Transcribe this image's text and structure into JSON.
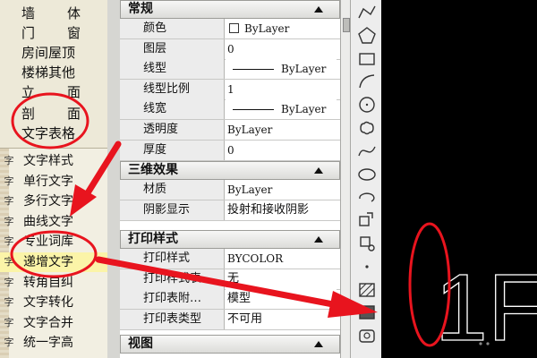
{
  "menu": {
    "top_items": [
      {
        "label": "墙体"
      },
      {
        "label": "门窗"
      },
      {
        "label": "房间屋顶"
      },
      {
        "label": "楼梯其他"
      },
      {
        "label": "立面"
      },
      {
        "label": "剖面"
      },
      {
        "label": "文字表格"
      }
    ],
    "sub_items": [
      {
        "label": "文字样式",
        "icon": "text-style-icon"
      },
      {
        "label": "单行文字",
        "icon": "single-line-text-icon"
      },
      {
        "label": "多行文字",
        "icon": "multiline-text-icon"
      },
      {
        "label": "曲线文字",
        "icon": "curve-text-icon"
      },
      {
        "label": "专业词库",
        "icon": "dictionary-icon"
      },
      {
        "label": "递增文字",
        "icon": "increment-text-icon",
        "highlighted": true
      },
      {
        "label": "转角自纠",
        "icon": "corner-text-icon"
      },
      {
        "label": "文字转化",
        "icon": "text-convert-icon"
      },
      {
        "label": "文字合并",
        "icon": "text-merge-icon"
      },
      {
        "label": "统一字高",
        "icon": "uniform-height-icon"
      }
    ]
  },
  "palette": {
    "sections": [
      {
        "title": "常规",
        "rows": [
          {
            "name": "颜色",
            "value": "ByLayer",
            "swatch": true
          },
          {
            "name": "图层",
            "value": "0"
          },
          {
            "name": "线型",
            "value": "ByLayer",
            "line": true
          },
          {
            "name": "线型比例",
            "value": "1"
          },
          {
            "name": "线宽",
            "value": "ByLayer",
            "line": true
          },
          {
            "name": "透明度",
            "value": "ByLayer"
          },
          {
            "name": "厚度",
            "value": "0"
          }
        ]
      },
      {
        "title": "三维效果",
        "rows": [
          {
            "name": "材质",
            "value": "ByLayer"
          },
          {
            "name": "阴影显示",
            "value": "投射和接收阴影"
          }
        ]
      },
      {
        "title": "打印样式",
        "rows": [
          {
            "name": "打印样式",
            "value": "BYCOLOR"
          },
          {
            "name": "打印样式表",
            "value": "无"
          },
          {
            "name": "打印表附…",
            "value": "模型"
          },
          {
            "name": "打印表类型",
            "value": "不可用"
          }
        ]
      },
      {
        "title": "视图",
        "rows": []
      }
    ]
  },
  "toolbar": {
    "tools": [
      "polyline-icon",
      "polygon-icon",
      "rectangle-icon",
      "arc-icon",
      "circle-icon",
      "revcloud-icon",
      "spline-icon",
      "ellipse-icon",
      "ellipse-arc-icon",
      "insert-block-icon",
      "make-block-icon",
      "point-icon",
      "hatch-icon",
      "gradient-icon",
      "region-icon"
    ]
  },
  "canvas": {
    "text": "1F"
  },
  "colors": {
    "annotation": "#e8141e",
    "highlight": "#fbf4a8",
    "canvas_bg": "#000000"
  }
}
